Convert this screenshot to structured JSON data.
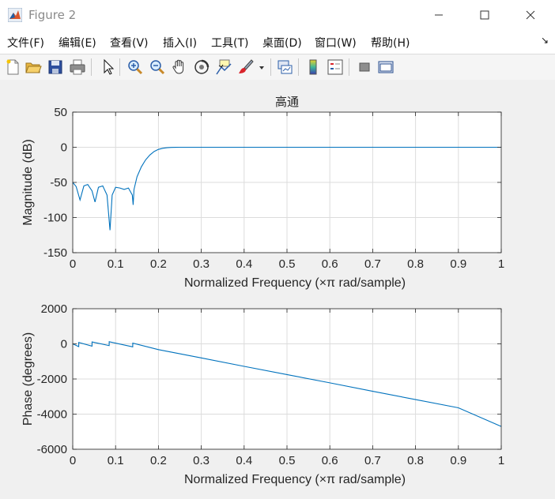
{
  "window": {
    "title": "Figure 2"
  },
  "menu": [
    "文件(F)",
    "编辑(E)",
    "查看(V)",
    "插入(I)",
    "工具(T)",
    "桌面(D)",
    "窗口(W)",
    "帮助(H)"
  ],
  "menu_arrow": "↘",
  "toolbar": [
    "new-figure-icon",
    "open-file-icon",
    "save-icon",
    "print-icon",
    "pointer-icon",
    "zoom-in-icon",
    "zoom-out-icon",
    "pan-hand-icon",
    "rotate-3d-icon",
    "data-cursor-icon",
    "brush-icon",
    "brush-dropdown-icon",
    "link-plot-icon",
    "colorbar-icon",
    "legend-icon",
    "hide-plot-tools-icon",
    "show-plot-tools-icon"
  ],
  "chart_data": [
    {
      "type": "line",
      "title": "高通",
      "xlabel": "Normalized Frequency  (×π rad/sample)",
      "ylabel": "Magnitude (dB)",
      "xlim": [
        0,
        1
      ],
      "ylim": [
        -150,
        50
      ],
      "xticks": [
        "0",
        "0.1",
        "0.2",
        "0.3",
        "0.4",
        "0.5",
        "0.6",
        "0.7",
        "0.8",
        "0.9",
        "1"
      ],
      "yticks": [
        "50",
        "0",
        "-50",
        "-100",
        "-150"
      ],
      "grid": true,
      "series": [
        {
          "color": "#0072bd",
          "x": [
            0,
            0.008,
            0.017,
            0.026,
            0.035,
            0.045,
            0.052,
            0.06,
            0.07,
            0.08,
            0.087,
            0.092,
            0.1,
            0.11,
            0.12,
            0.13,
            0.139,
            0.141,
            0.143,
            0.15,
            0.16,
            0.17,
            0.18,
            0.19,
            0.2,
            0.21,
            0.22,
            0.23,
            0.24,
            0.25,
            0.26,
            0.3,
            0.4,
            0.5,
            0.6,
            0.7,
            0.8,
            0.9,
            1.0
          ],
          "y": [
            -50,
            -56,
            -75,
            -55,
            -53,
            -62,
            -78,
            -57,
            -55,
            -68,
            -118,
            -68,
            -57,
            -58,
            -60,
            -58,
            -68,
            -82,
            -60,
            -42,
            -28,
            -18,
            -11,
            -6,
            -3,
            -1.5,
            -0.6,
            -0.2,
            -0.05,
            0,
            0,
            0,
            0,
            0,
            0,
            0,
            0,
            0,
            0
          ]
        }
      ]
    },
    {
      "type": "line",
      "title": "",
      "xlabel": "Normalized Frequency  (×π rad/sample)",
      "ylabel": "Phase (degrees)",
      "xlim": [
        0,
        1
      ],
      "ylim": [
        -6000,
        2000
      ],
      "xticks": [
        "0",
        "0.1",
        "0.2",
        "0.3",
        "0.4",
        "0.5",
        "0.6",
        "0.7",
        "0.8",
        "0.9",
        "1"
      ],
      "yticks": [
        "2000",
        "0",
        "-2000",
        "-4000",
        "-6000"
      ],
      "grid": true,
      "series": [
        {
          "color": "#0072bd",
          "x": [
            0,
            0.014,
            0.0141,
            0.045,
            0.0451,
            0.085,
            0.0851,
            0.14,
            0.1401,
            0.2,
            0.3,
            0.4,
            0.5,
            0.6,
            0.7,
            0.8,
            0.9,
            1.0
          ],
          "y": [
            0,
            -160,
            80,
            -130,
            110,
            -100,
            120,
            -170,
            40,
            -330,
            -800,
            -1280,
            -1750,
            -2220,
            -2700,
            -3170,
            -3640,
            -4700
          ]
        }
      ]
    }
  ]
}
